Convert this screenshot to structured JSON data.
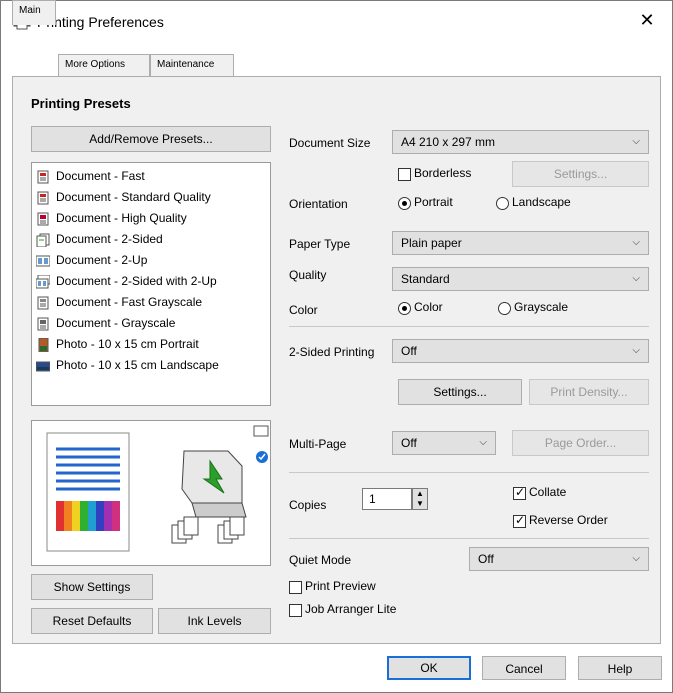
{
  "window": {
    "title": "Printing Preferences",
    "close_symbol": "✕"
  },
  "tabs": [
    {
      "label": "Main",
      "active": true
    },
    {
      "label": "More Options",
      "active": false
    },
    {
      "label": "Maintenance",
      "active": false
    }
  ],
  "presets": {
    "heading": "Printing Presets",
    "add_remove_button": "Add/Remove Presets...",
    "items": [
      {
        "label": "Document - Fast",
        "icon": "document-fast-icon"
      },
      {
        "label": "Document - Standard Quality",
        "icon": "document-standard-icon"
      },
      {
        "label": "Document - High Quality",
        "icon": "document-high-quality-icon"
      },
      {
        "label": "Document - 2-Sided",
        "icon": "document-2-sided-icon"
      },
      {
        "label": "Document - 2-Up",
        "icon": "document-2-up-icon"
      },
      {
        "label": "Document - 2-Sided with 2-Up",
        "icon": "document-2-sided-2-up-icon"
      },
      {
        "label": "Document - Fast Grayscale",
        "icon": "document-fast-grayscale-icon"
      },
      {
        "label": "Document - Grayscale",
        "icon": "document-grayscale-icon"
      },
      {
        "label": "Photo - 10 x 15 cm Portrait",
        "icon": "photo-portrait-icon"
      },
      {
        "label": "Photo - 10 x 15 cm Landscape",
        "icon": "photo-landscape-icon"
      }
    ]
  },
  "left_buttons": {
    "show_settings": "Show Settings",
    "reset_defaults": "Reset Defaults",
    "ink_levels": "Ink Levels"
  },
  "settings": {
    "document_size": {
      "label": "Document Size",
      "value": "A4 210 x 297 mm"
    },
    "borderless": {
      "label": "Borderless",
      "checked": false
    },
    "borderless_settings": "Settings...",
    "orientation": {
      "label": "Orientation",
      "portrait": "Portrait",
      "landscape": "Landscape",
      "selected": "Portrait"
    },
    "paper_type": {
      "label": "Paper Type",
      "value": "Plain paper"
    },
    "quality": {
      "label": "Quality",
      "value": "Standard"
    },
    "color": {
      "label": "Color",
      "color": "Color",
      "grayscale": "Grayscale",
      "selected": "Color"
    },
    "two_sided": {
      "label": "2-Sided Printing",
      "value": "Off"
    },
    "two_sided_settings": "Settings...",
    "print_density": "Print Density...",
    "multi_page": {
      "label": "Multi-Page",
      "value": "Off"
    },
    "page_order": "Page Order...",
    "copies": {
      "label": "Copies",
      "value": "1"
    },
    "collate": {
      "label": "Collate",
      "checked": true
    },
    "reverse_order": {
      "label": "Reverse Order",
      "checked": true
    },
    "quiet_mode": {
      "label": "Quiet Mode",
      "value": "Off"
    },
    "print_preview": {
      "label": "Print Preview",
      "checked": false
    },
    "job_arranger": {
      "label": "Job Arranger Lite",
      "checked": false
    }
  },
  "footer": {
    "ok": "OK",
    "cancel": "Cancel",
    "help": "Help"
  },
  "colors": {
    "accent": "#1a6fd6",
    "panel": "#f0f0f0",
    "button": "#e1e1e1",
    "border": "#adadad",
    "green_arrow": "#2aa02a"
  }
}
